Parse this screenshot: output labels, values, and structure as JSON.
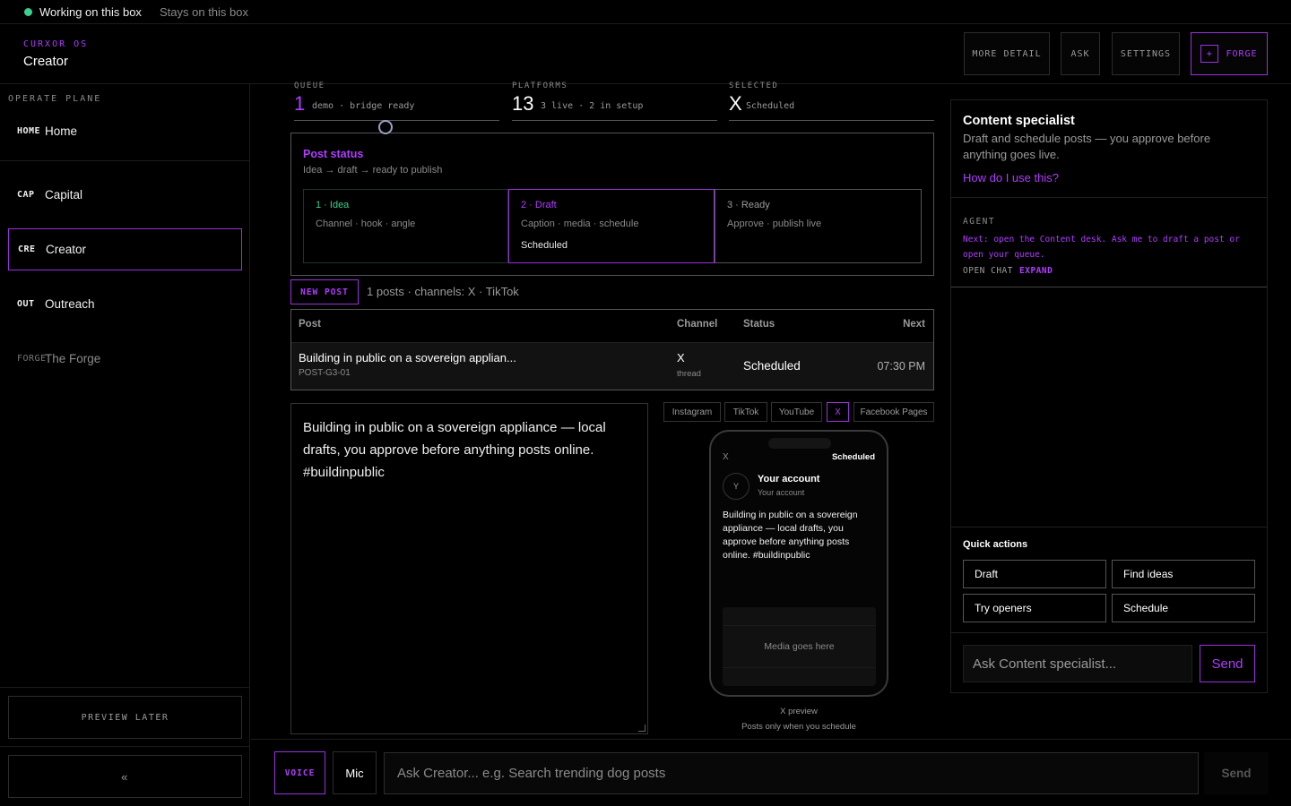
{
  "status_bar": {
    "working": "Working on this box",
    "stays": "Stays on this box",
    "dot_color": "#3ecf8e"
  },
  "header": {
    "brand_os": "CURXOR OS",
    "title": "Creator",
    "buttons": {
      "more_detail": "MORE DETAIL",
      "ask": "ASK",
      "settings": "SETTINGS",
      "forge": "FORGE",
      "forge_icon": "+"
    }
  },
  "sidebar": {
    "section": "OPERATE PLANE",
    "items": [
      {
        "abbr": "HOME",
        "label": "Home"
      },
      {
        "abbr": "CAP",
        "label": "Capital"
      },
      {
        "abbr": "CRE",
        "label": "Creator",
        "active": true
      },
      {
        "abbr": "OUT",
        "label": "Outreach"
      },
      {
        "abbr": "FORGE",
        "label": "The Forge"
      }
    ],
    "preview_later": "PREVIEW LATER",
    "collapse": "«"
  },
  "metrics": {
    "queue": {
      "label": "QUEUE",
      "value": "1",
      "sub": "demo · bridge ready"
    },
    "platforms": {
      "label": "PLATFORMS",
      "value": "13",
      "sub": "3 live · 2 in setup"
    },
    "selected": {
      "label": "SELECTED",
      "value": "X",
      "sub": "Scheduled"
    }
  },
  "post_status": {
    "title": "Post status",
    "subtitle": "Idea → draft → ready to publish",
    "stages": [
      {
        "title": "1 · Idea",
        "desc": "Channel · hook · angle"
      },
      {
        "title": "2 · Draft",
        "desc": "Caption · media · schedule",
        "note": "Scheduled"
      },
      {
        "title": "3 · Ready",
        "desc": "Approve · publish live"
      }
    ]
  },
  "new_post": {
    "button": "NEW POST",
    "summary": "1 posts · channels: X · TikTok"
  },
  "table": {
    "headers": {
      "post": "Post",
      "channel": "Channel",
      "status": "Status",
      "next": "Next"
    },
    "rows": [
      {
        "title": "Building in public on a sovereign applian...",
        "id": "POST-G3-01",
        "channel": "X",
        "channel_sub": "thread",
        "status": "Scheduled",
        "next": "07:30 PM"
      }
    ]
  },
  "editor": {
    "text": "Building in public on a sovereign appliance — local drafts, you approve before anything posts online. #buildinpublic"
  },
  "platform_tabs": [
    "Instagram",
    "TikTok",
    "YouTube",
    "X",
    "Facebook Pages"
  ],
  "preview": {
    "network": "X",
    "status": "Scheduled",
    "avatar": "Y",
    "account": "Your account",
    "handle": "Your account",
    "body": "Building in public on a sovereign appliance — local drafts, you approve before anything posts online. #buildinpublic",
    "media": "Media goes here",
    "label": "X preview",
    "note": "Posts only when you schedule"
  },
  "right_panel": {
    "title": "Content specialist",
    "desc": "Draft and schedule posts — you approve before anything goes live.",
    "help": "How do I use this?",
    "agent_label": "AGENT",
    "agent_msg": "Next: open the Content desk. Ask me to draft a post or open your queue.",
    "open_chat": "OPEN CHAT",
    "expand": "EXPAND",
    "quick_actions_label": "Quick actions",
    "quick_actions": [
      "Draft",
      "Find ideas",
      "Try openers",
      "Schedule"
    ],
    "input_placeholder": "Ask Content specialist...",
    "send": "Send"
  },
  "bottom_bar": {
    "voice": "VOICE",
    "mic": "Mic",
    "input_placeholder": "Ask Creator... e.g. Search trending dog posts",
    "send": "Send"
  },
  "colors": {
    "accent": "#b03cff",
    "accent_border": "#9b30e0",
    "success": "#3ecf8e",
    "background": "#000000"
  }
}
